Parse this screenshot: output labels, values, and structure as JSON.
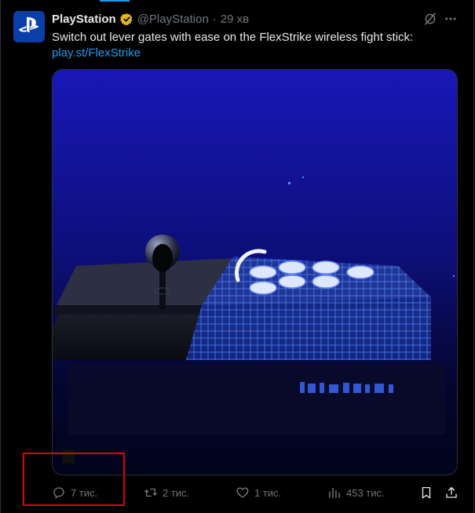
{
  "tweet": {
    "author": {
      "name": "PlayStation",
      "handle": "@PlayStation",
      "separator": "·",
      "time": "29 хв",
      "avatar_icon": "playstation-logo-icon",
      "verified_icon": "gold-verified-badge-icon"
    },
    "text": "Switch out lever gates with ease on the FlexStrike wireless fight stick:",
    "link": "play.st/FlexStrike",
    "media": {
      "type": "image",
      "subject": "arcade fight stick with joystick and round buttons, blue holographic grid"
    },
    "actions": {
      "replies": "7 тис.",
      "reposts": "2 тис.",
      "likes": "1 тис.",
      "views": "453 тис."
    },
    "header_icons": [
      "grok-icon",
      "more-options-icon"
    ],
    "action_icons": [
      "reply-icon",
      "repost-icon",
      "like-icon",
      "views-icon",
      "bookmark-icon",
      "share-icon"
    ]
  },
  "colors": {
    "background": "#000000",
    "text": "#e7e9ea",
    "muted": "#71767b",
    "link": "#1d9bf0",
    "verified": "#e2b719",
    "highlight_box": "#e00000"
  }
}
